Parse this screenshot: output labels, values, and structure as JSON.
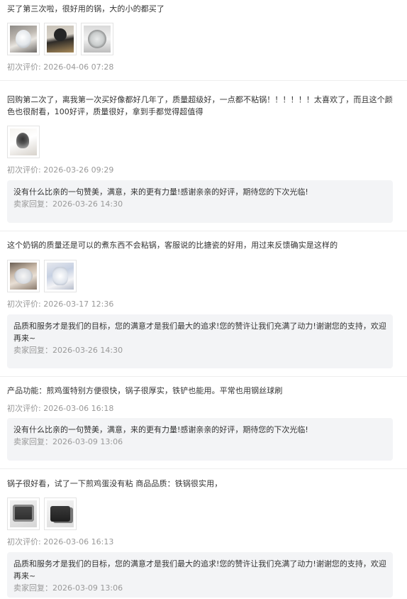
{
  "reviews": [
    {
      "text": "买了第三次啦，很好用的锅，大的小的都买了",
      "images": [
        "photo-1",
        "photo-2",
        "photo-3"
      ],
      "date_label": "初次评价: 2026-04-06 07:28"
    },
    {
      "text": "回购第二次了，离我第一次买好像都好几年了，质量超级好，一点都不粘锅！！！！！！太喜欢了，而且这个颜色也很耐看，100好评，质量很好，拿到手都觉得超值得",
      "images": [
        "photo-1"
      ],
      "date_label": "初次评价: 2026-03-26 09:29",
      "reply": {
        "text": "没有什么比亲的一句赞美，满意，来的更有力量!感谢亲亲的好评，期待您的下次光临!",
        "date_label": "卖家回复：2026-03-26 14:30"
      }
    },
    {
      "text": "这个奶锅的质量还是可以的煮东西不会粘锅，客服说的比搪瓷的好用，用过来反馈确实是这样的",
      "images": [
        "photo-1",
        "photo-2"
      ],
      "date_label": "初次评价: 2026-03-17 12:36",
      "reply": {
        "text": "品质和服务才是我们的目标，您的满意才是我们最大的追求!您的赞许让我们充满了动力!谢谢您的支持，欢迎再来~",
        "date_label": "卖家回复：2026-03-26 14:30"
      }
    },
    {
      "text": "产品功能：煎鸡蛋特别方便很快，锅子很厚实，铁铲也能用。平常也用钢丝球刷",
      "images": [],
      "date_label": "初次评价: 2026-03-06 16:18",
      "reply": {
        "text": "没有什么比亲的一句赞美，满意，来的更有力量!感谢亲亲的好评，期待您的下次光临!",
        "date_label": "卖家回复：2026-03-09 13:06"
      }
    },
    {
      "text": "锅子很好看，试了一下煎鸡蛋没有粘 商品品质：铁锅很实用，",
      "images": [
        "photo-1",
        "photo-2"
      ],
      "date_label": "初次评价: 2026-03-06 16:13",
      "reply": {
        "text": "品质和服务才是我们的目标，您的满意才是我们最大的追求!您的赞许让我们充满了动力!谢谢您的支持，欢迎再来~",
        "date_label": "卖家回复：2026-03-09 13:06"
      }
    }
  ]
}
